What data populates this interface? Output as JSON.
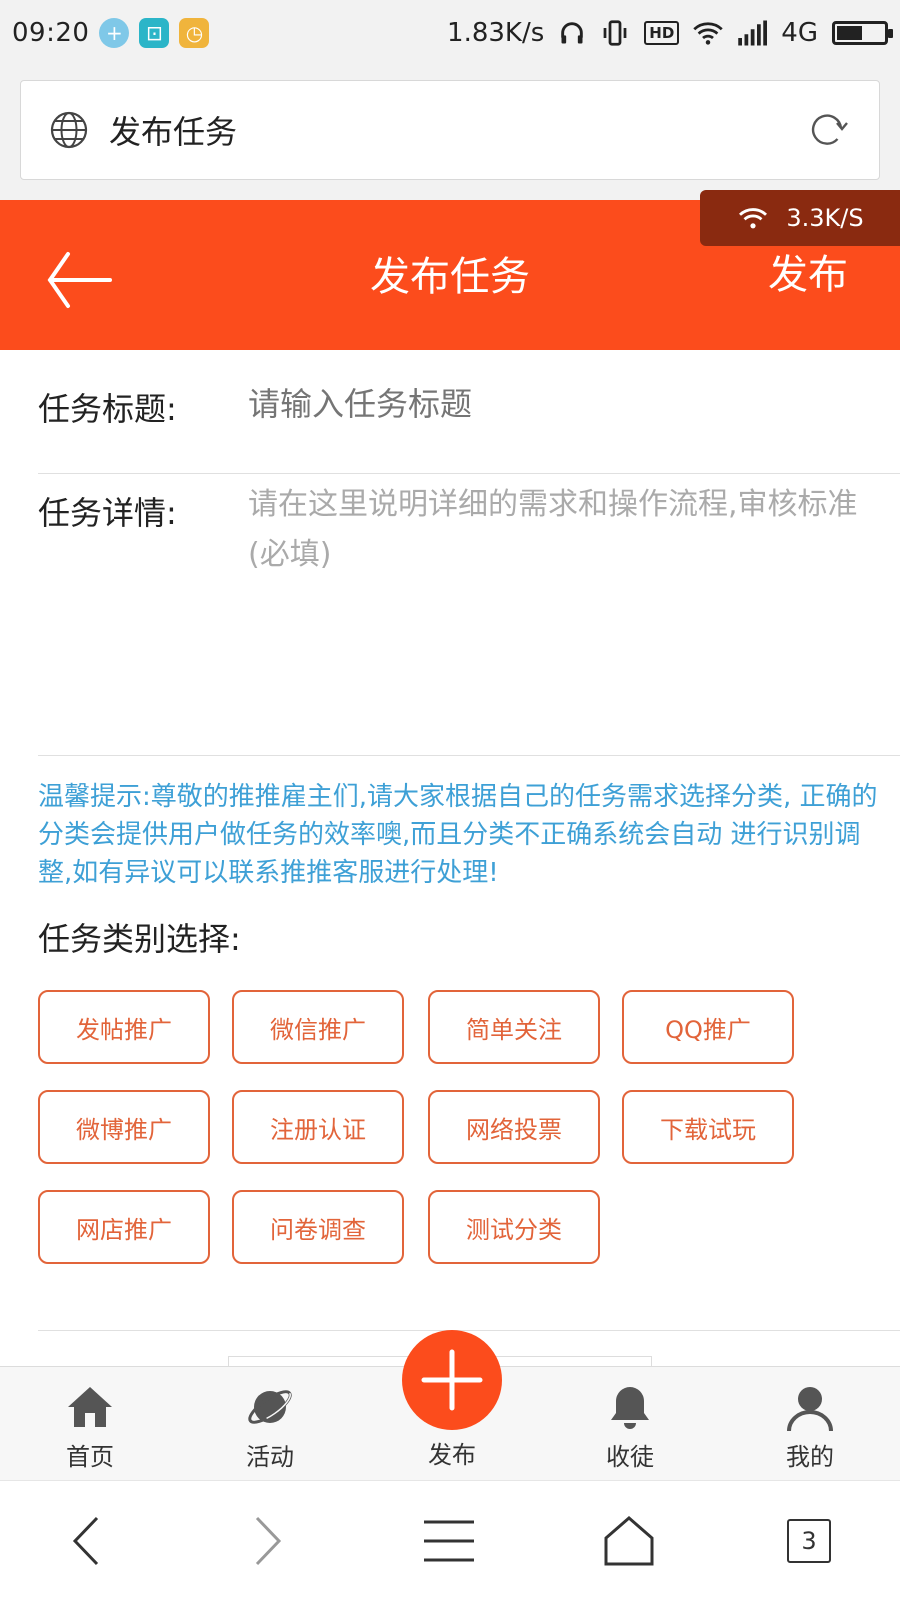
{
  "status_bar": {
    "time": "09:20",
    "speed": "1.83K/s",
    "hd": "HD",
    "network": "4G"
  },
  "browser": {
    "page_title": "发布任务",
    "overlay_speed": "3.3K/S"
  },
  "header": {
    "title": "发布任务",
    "publish_label": "发布"
  },
  "form": {
    "title_label": "任务标题:",
    "title_placeholder": "请输入任务标题",
    "detail_label": "任务详情:",
    "detail_placeholder": "请在这里说明详细的需求和操作流程,审核标准(必填)"
  },
  "tip": "温馨提示:尊敬的推推雇主们,请大家根据自己的任务需求选择分类, 正确的分类会提供用户做任务的效率噢,而且分类不正确系统会自动 进行识别调整,如有异议可以联系推推客服进行处理!",
  "category_label": "任务类别选择:",
  "categories": [
    "发帖推广",
    "微信推广",
    "简单关注",
    "QQ推广",
    "微博推广",
    "注册认证",
    "网络投票",
    "下载试玩",
    "网店推广",
    "问卷调查",
    "测试分类"
  ],
  "tabbar": {
    "home": "首页",
    "activity": "活动",
    "publish": "发布",
    "disciples": "收徒",
    "mine": "我的"
  },
  "sysnav": {
    "tab_count": "3"
  },
  "colors": {
    "accent": "#fc4c1c",
    "category_border": "#e2643a",
    "tip_text": "#3ea0d6"
  }
}
